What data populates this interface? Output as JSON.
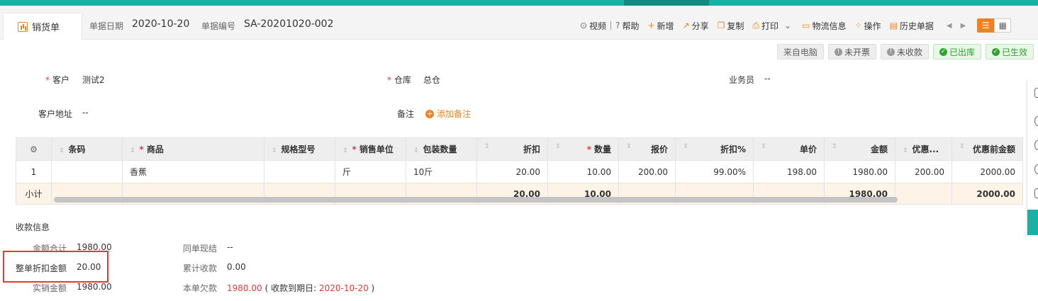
{
  "header": {
    "tab_label": "销货单",
    "date_label": "单据日期",
    "date_value": "2020-10-20",
    "no_label": "单据编号",
    "no_value": "SA-20201020-002"
  },
  "toolbar": {
    "video": "视频",
    "help": "帮助",
    "add": "新增",
    "share": "分享",
    "copy": "复制",
    "print": "打印",
    "logistics": "物流信息",
    "operate": "操作",
    "history": "历史单据"
  },
  "badges": [
    "来自电脑",
    "未开票",
    "未收款",
    "已出库",
    "已生效"
  ],
  "form": {
    "customer_label": "客户",
    "customer_value": "测试2",
    "warehouse_label": "仓库",
    "warehouse_value": "总仓",
    "salesman_label": "业务员",
    "salesman_value": "--",
    "address_label": "客户地址",
    "address_value": "--",
    "remark_label": "备注",
    "add_remark": "添加备注"
  },
  "table": {
    "headers": [
      "条码",
      "商品",
      "规格型号",
      "销售单位",
      "包装数量",
      "折扣",
      "数量",
      "报价",
      "折扣%",
      "单价",
      "金额",
      "优惠...",
      "优惠前金额"
    ],
    "rows": [
      {
        "idx": "1",
        "barcode": "",
        "product": "香蕉",
        "spec": "",
        "unit": "斤",
        "pack": "10斤",
        "discount": "20.00",
        "qty": "10.00",
        "quote": "200.00",
        "discount_pct": "99.00%",
        "price": "198.00",
        "amount": "1980.00",
        "promo": "200.00",
        "pre_amount": "2000.00"
      }
    ],
    "subtotal": {
      "label": "小计",
      "discount": "20.00",
      "qty": "10.00",
      "amount": "1980.00",
      "pre_amount": "2000.00"
    }
  },
  "receipt": {
    "title": "收款信息",
    "total_label": "金额合计",
    "total_value": "1980.00",
    "whole_discount_label": "整单折扣金额",
    "whole_discount_value": "20.00",
    "actual_label": "实销金额",
    "actual_value": "1980.00",
    "settle_label": "同单现结",
    "settle_value": "--",
    "cumulative_label": "累计收款",
    "cumulative_value": "0.00",
    "owed_label": "本单欠款",
    "owed_value": "1980.00",
    "due_prefix": "( 收款到期日: ",
    "due_date": "2020-10-20",
    "due_suffix": " )"
  },
  "colors": {
    "accent": "#f0821e",
    "teal": "#1ab0a4",
    "red": "#e53935",
    "green": "#2e9e2e"
  }
}
